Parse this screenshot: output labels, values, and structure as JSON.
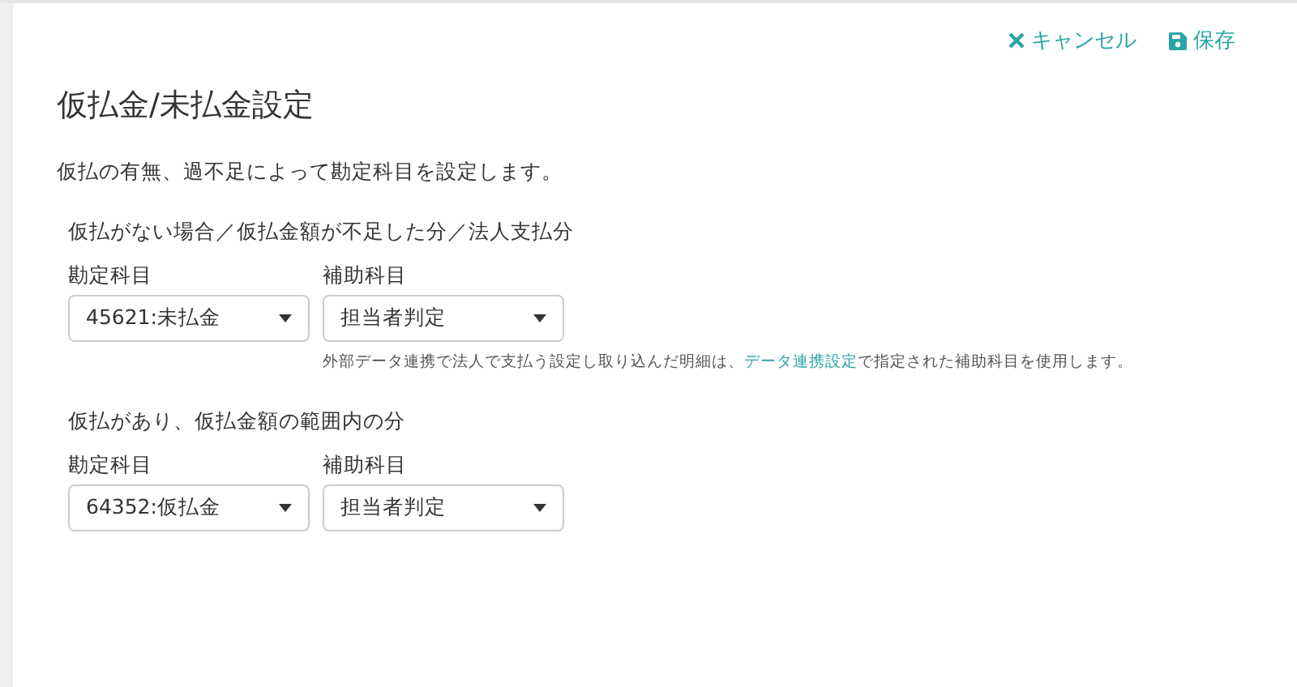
{
  "actions": [
    {
      "kind": "cancel",
      "label": "キャンセル"
    },
    {
      "kind": "save",
      "label": "保存"
    }
  ],
  "title": "仮払金/未払金設定",
  "description": "仮払の有無、過不足によって勘定科目を設定します。",
  "sections": [
    {
      "heading": "仮払がない場合／仮払金額が不足した分／法人支払分",
      "fields": [
        {
          "label": "勘定科目",
          "value": "45621:未払金"
        },
        {
          "label": "補助科目",
          "value": "担当者判定"
        }
      ],
      "note": {
        "before": "外部データ連携で法人で支払う設定し取り込んだ明細は、",
        "link": "データ連携設定",
        "after": "で指定された補助科目を使用します。"
      }
    },
    {
      "heading": "仮払があり、仮払金額の範囲内の分",
      "fields": [
        {
          "label": "勘定科目",
          "value": "64352:仮払金"
        },
        {
          "label": "補助科目",
          "value": "担当者判定"
        }
      ]
    }
  ]
}
